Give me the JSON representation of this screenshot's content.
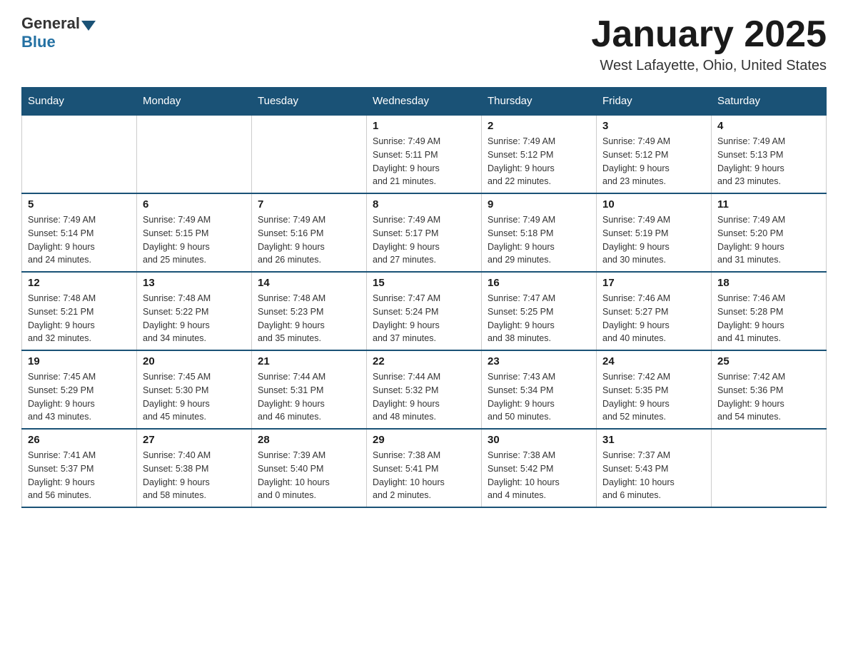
{
  "header": {
    "logo_general": "General",
    "logo_blue": "Blue",
    "title": "January 2025",
    "location": "West Lafayette, Ohio, United States"
  },
  "weekdays": [
    "Sunday",
    "Monday",
    "Tuesday",
    "Wednesday",
    "Thursday",
    "Friday",
    "Saturday"
  ],
  "weeks": [
    [
      {
        "day": "",
        "info": ""
      },
      {
        "day": "",
        "info": ""
      },
      {
        "day": "",
        "info": ""
      },
      {
        "day": "1",
        "info": "Sunrise: 7:49 AM\nSunset: 5:11 PM\nDaylight: 9 hours\nand 21 minutes."
      },
      {
        "day": "2",
        "info": "Sunrise: 7:49 AM\nSunset: 5:12 PM\nDaylight: 9 hours\nand 22 minutes."
      },
      {
        "day": "3",
        "info": "Sunrise: 7:49 AM\nSunset: 5:12 PM\nDaylight: 9 hours\nand 23 minutes."
      },
      {
        "day": "4",
        "info": "Sunrise: 7:49 AM\nSunset: 5:13 PM\nDaylight: 9 hours\nand 23 minutes."
      }
    ],
    [
      {
        "day": "5",
        "info": "Sunrise: 7:49 AM\nSunset: 5:14 PM\nDaylight: 9 hours\nand 24 minutes."
      },
      {
        "day": "6",
        "info": "Sunrise: 7:49 AM\nSunset: 5:15 PM\nDaylight: 9 hours\nand 25 minutes."
      },
      {
        "day": "7",
        "info": "Sunrise: 7:49 AM\nSunset: 5:16 PM\nDaylight: 9 hours\nand 26 minutes."
      },
      {
        "day": "8",
        "info": "Sunrise: 7:49 AM\nSunset: 5:17 PM\nDaylight: 9 hours\nand 27 minutes."
      },
      {
        "day": "9",
        "info": "Sunrise: 7:49 AM\nSunset: 5:18 PM\nDaylight: 9 hours\nand 29 minutes."
      },
      {
        "day": "10",
        "info": "Sunrise: 7:49 AM\nSunset: 5:19 PM\nDaylight: 9 hours\nand 30 minutes."
      },
      {
        "day": "11",
        "info": "Sunrise: 7:49 AM\nSunset: 5:20 PM\nDaylight: 9 hours\nand 31 minutes."
      }
    ],
    [
      {
        "day": "12",
        "info": "Sunrise: 7:48 AM\nSunset: 5:21 PM\nDaylight: 9 hours\nand 32 minutes."
      },
      {
        "day": "13",
        "info": "Sunrise: 7:48 AM\nSunset: 5:22 PM\nDaylight: 9 hours\nand 34 minutes."
      },
      {
        "day": "14",
        "info": "Sunrise: 7:48 AM\nSunset: 5:23 PM\nDaylight: 9 hours\nand 35 minutes."
      },
      {
        "day": "15",
        "info": "Sunrise: 7:47 AM\nSunset: 5:24 PM\nDaylight: 9 hours\nand 37 minutes."
      },
      {
        "day": "16",
        "info": "Sunrise: 7:47 AM\nSunset: 5:25 PM\nDaylight: 9 hours\nand 38 minutes."
      },
      {
        "day": "17",
        "info": "Sunrise: 7:46 AM\nSunset: 5:27 PM\nDaylight: 9 hours\nand 40 minutes."
      },
      {
        "day": "18",
        "info": "Sunrise: 7:46 AM\nSunset: 5:28 PM\nDaylight: 9 hours\nand 41 minutes."
      }
    ],
    [
      {
        "day": "19",
        "info": "Sunrise: 7:45 AM\nSunset: 5:29 PM\nDaylight: 9 hours\nand 43 minutes."
      },
      {
        "day": "20",
        "info": "Sunrise: 7:45 AM\nSunset: 5:30 PM\nDaylight: 9 hours\nand 45 minutes."
      },
      {
        "day": "21",
        "info": "Sunrise: 7:44 AM\nSunset: 5:31 PM\nDaylight: 9 hours\nand 46 minutes."
      },
      {
        "day": "22",
        "info": "Sunrise: 7:44 AM\nSunset: 5:32 PM\nDaylight: 9 hours\nand 48 minutes."
      },
      {
        "day": "23",
        "info": "Sunrise: 7:43 AM\nSunset: 5:34 PM\nDaylight: 9 hours\nand 50 minutes."
      },
      {
        "day": "24",
        "info": "Sunrise: 7:42 AM\nSunset: 5:35 PM\nDaylight: 9 hours\nand 52 minutes."
      },
      {
        "day": "25",
        "info": "Sunrise: 7:42 AM\nSunset: 5:36 PM\nDaylight: 9 hours\nand 54 minutes."
      }
    ],
    [
      {
        "day": "26",
        "info": "Sunrise: 7:41 AM\nSunset: 5:37 PM\nDaylight: 9 hours\nand 56 minutes."
      },
      {
        "day": "27",
        "info": "Sunrise: 7:40 AM\nSunset: 5:38 PM\nDaylight: 9 hours\nand 58 minutes."
      },
      {
        "day": "28",
        "info": "Sunrise: 7:39 AM\nSunset: 5:40 PM\nDaylight: 10 hours\nand 0 minutes."
      },
      {
        "day": "29",
        "info": "Sunrise: 7:38 AM\nSunset: 5:41 PM\nDaylight: 10 hours\nand 2 minutes."
      },
      {
        "day": "30",
        "info": "Sunrise: 7:38 AM\nSunset: 5:42 PM\nDaylight: 10 hours\nand 4 minutes."
      },
      {
        "day": "31",
        "info": "Sunrise: 7:37 AM\nSunset: 5:43 PM\nDaylight: 10 hours\nand 6 minutes."
      },
      {
        "day": "",
        "info": ""
      }
    ]
  ]
}
